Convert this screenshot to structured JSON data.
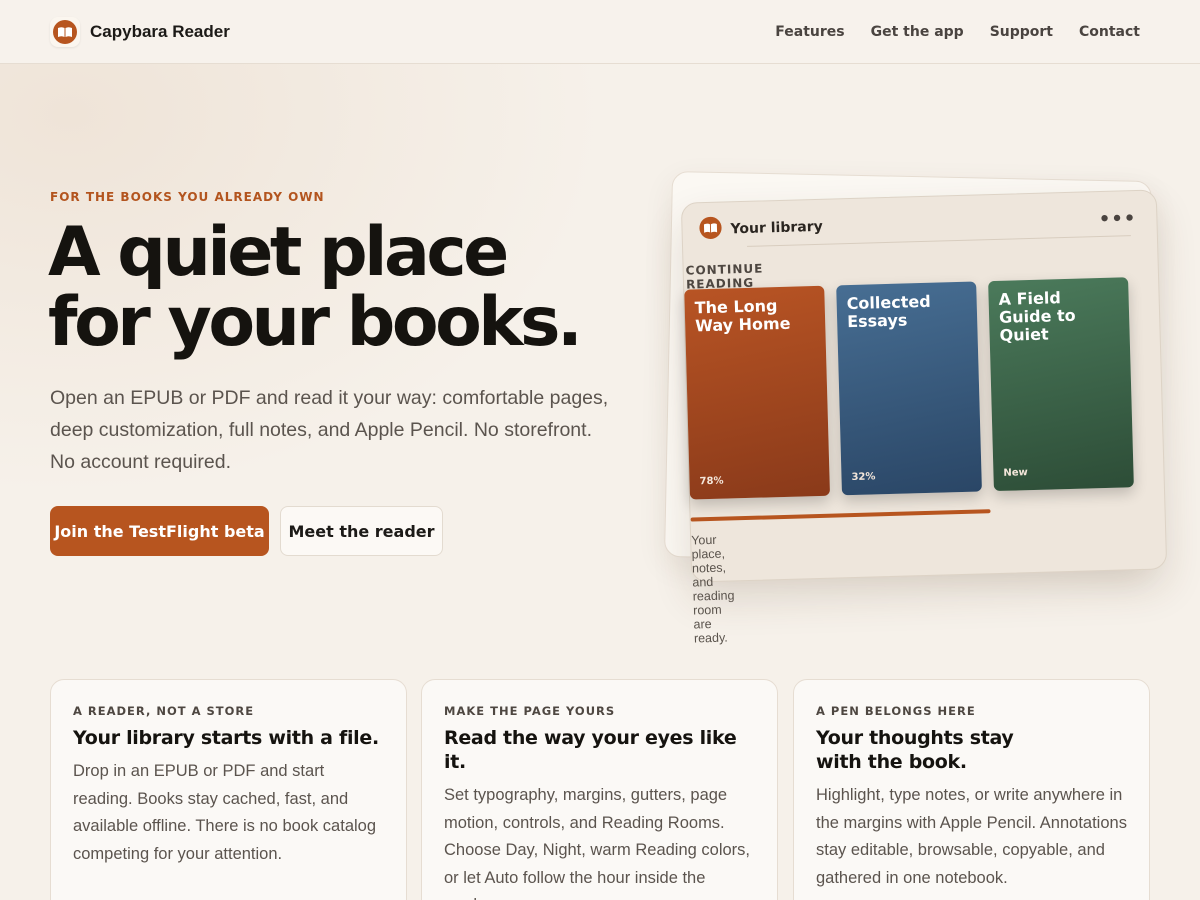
{
  "header": {
    "brand_name": "Capybara Reader",
    "brand_icon": "open-book-icon",
    "nav": [
      {
        "label": "Features"
      },
      {
        "label": "Get the app"
      },
      {
        "label": "Support"
      },
      {
        "label": "Contact"
      }
    ]
  },
  "hero": {
    "eyebrow": "FOR THE BOOKS YOU ALREADY OWN",
    "headline_line1": "A quiet place",
    "headline_line2": "for your books.",
    "lede": "Open an EPUB or PDF and read it your way: comfortable pages, deep customization, full notes, and Apple Pencil. No storefront. No account required.",
    "primary_cta": "Join the TestFlight beta",
    "secondary_cta": "Meet the reader"
  },
  "library_card": {
    "title": "Your library",
    "more_label": "•••",
    "section_label": "CONTINUE READING",
    "books": [
      {
        "title": "The Long Way Home",
        "meta": "78%",
        "color": "#b85424"
      },
      {
        "title": "Collected Essays",
        "meta": "32%",
        "color": "#476e93"
      },
      {
        "title": "A Field Guide to Quiet",
        "meta": "New",
        "color": "#4b7a5b"
      }
    ],
    "footer": "Your place, notes, and reading room are ready."
  },
  "features": [
    {
      "eyebrow": "A READER, NOT A STORE",
      "title": "Your library starts with a file.",
      "body": "Drop in an EPUB or PDF and start reading. Books stay cached, fast, and available offline. There is no book catalog competing for your attention."
    },
    {
      "eyebrow": "MAKE THE PAGE YOURS",
      "title": "Read the way your eyes like it.",
      "body": "Set typography, margins, gutters, page motion, controls, and Reading Rooms. Choose Day, Night, warm Reading colors, or let Auto follow the hour inside the reader."
    },
    {
      "eyebrow": "A PEN BELONGS HERE",
      "title": "Your thoughts stay with the book.",
      "body": "Highlight, type notes, or write anywhere in the margins with Apple Pencil. Annotations stay editable, browsable, copyable, and gathered in one notebook."
    }
  ],
  "colors": {
    "accent": "#b7551f",
    "background": "#f6f1ea"
  }
}
